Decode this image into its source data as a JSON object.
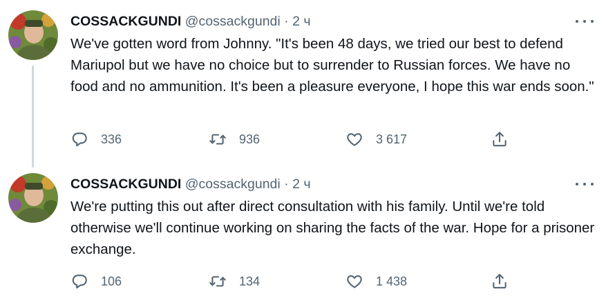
{
  "tweets": [
    {
      "author_name": "COSSACKGUNDI",
      "handle": "@cossackgundi",
      "separator": "·",
      "time": "2 ч",
      "text": "We've gotten word from Johnny. \"It's been 48 days, we tried our best to defend Mariupol but we have no choice but to surrender to Russian forces. We have no food and no ammunition. It's been a pleasure everyone, I hope this war ends soon.\"",
      "replies": "336",
      "retweets": "936",
      "likes": "3 617"
    },
    {
      "author_name": "COSSACKGUNDI",
      "handle": "@cossackgundi",
      "separator": "·",
      "time": "2 ч",
      "text": "We're putting this out after direct consultation with his family. Until we're told otherwise we'll continue working on sharing the facts of the war. Hope for a prisoner exchange.",
      "replies": "106",
      "retweets": "134",
      "likes": "1 438"
    }
  ],
  "icons": {
    "more": "more-dots-icon",
    "reply": "reply-bubble-icon",
    "retweet": "retweet-arrows-icon",
    "like": "heart-icon",
    "share": "share-upload-icon"
  },
  "colors": {
    "text_primary": "#0f1419",
    "text_secondary": "#536471",
    "thread_line": "#cfd9de"
  }
}
